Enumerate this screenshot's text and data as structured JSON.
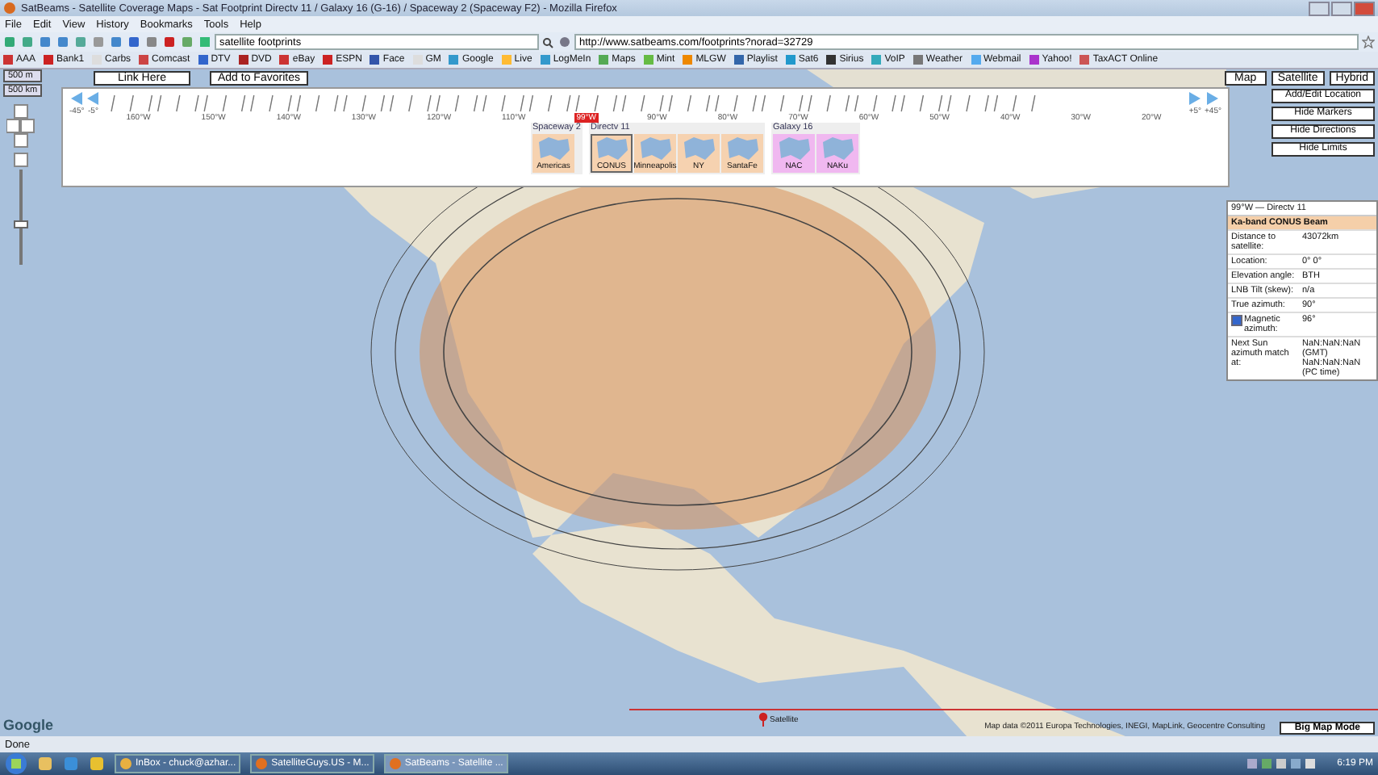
{
  "window": {
    "title": "SatBeams - Satellite Coverage Maps - Sat Footprint Directv 11 / Galaxy 16 (G-16) / Spaceway 2 (Spaceway F2) - Mozilla Firefox"
  },
  "menu": [
    "File",
    "Edit",
    "View",
    "History",
    "Bookmarks",
    "Tools",
    "Help"
  ],
  "search": {
    "value": "satellite footprints"
  },
  "address": {
    "value": "http://www.satbeams.com/footprints?norad=32729"
  },
  "bookmarks": [
    "AAA",
    "Bank1",
    "Carbs",
    "Comcast",
    "DTV",
    "DVD",
    "eBay",
    "ESPN",
    "Face",
    "GM",
    "Google",
    "Live",
    "LogMeIn",
    "Maps",
    "Mint",
    "MLGW",
    "Playlist",
    "Sat6",
    "Sirius",
    "VoIP",
    "Weather",
    "Webmail",
    "Yahoo!",
    "TaxACT Online"
  ],
  "scale": [
    "500 m",
    "500 km"
  ],
  "page_buttons": [
    "Link Here",
    "Add to Favorites"
  ],
  "map_types": [
    {
      "label": "Map",
      "selected": false
    },
    {
      "label": "Satellite",
      "selected": false
    },
    {
      "label": "Hybrid",
      "selected": false
    }
  ],
  "side_buttons": [
    "Add/Edit Location",
    "Hide Markers",
    "Hide Directions",
    "Hide Limits"
  ],
  "strip": {
    "left": [
      "-45°",
      "-5°"
    ],
    "right": [
      "+5°",
      "+45°"
    ],
    "longitudes": [
      {
        "label": "160°W",
        "selected": false
      },
      {
        "label": "150°W",
        "selected": false
      },
      {
        "label": "140°W",
        "selected": false
      },
      {
        "label": "130°W",
        "selected": false
      },
      {
        "label": "120°W",
        "selected": false
      },
      {
        "label": "110°W",
        "selected": false
      },
      {
        "label": "99°W",
        "selected": true
      },
      {
        "label": "90°W",
        "selected": false
      },
      {
        "label": "80°W",
        "selected": false
      },
      {
        "label": "70°W",
        "selected": false
      },
      {
        "label": "60°W",
        "selected": false
      },
      {
        "label": "50°W",
        "selected": false
      },
      {
        "label": "40°W",
        "selected": false
      },
      {
        "label": "30°W",
        "selected": false
      },
      {
        "label": "20°W",
        "selected": false
      }
    ],
    "satellites": [
      {
        "name": "Spaceway 2",
        "color": "#f6d2b0",
        "beams": [
          {
            "label": "Americas",
            "selected": false
          }
        ]
      },
      {
        "name": "Directv 11",
        "color": "#f6d2b0",
        "beams": [
          {
            "label": "CONUS",
            "selected": true
          },
          {
            "label": "Minneapolis",
            "selected": false
          },
          {
            "label": "NY",
            "selected": false
          },
          {
            "label": "SantaFe",
            "selected": false
          }
        ]
      },
      {
        "name": "Galaxy 16",
        "color": "#f0b8f0",
        "beams": [
          {
            "label": "NAC",
            "selected": false
          },
          {
            "label": "NAKu",
            "selected": false
          }
        ]
      }
    ]
  },
  "info": {
    "title": "99°W — Directv 11",
    "beam": "Ka-band CONUS Beam",
    "rows": [
      {
        "kind": "text",
        "label": "Distance to satellite:",
        "value": "43072km"
      },
      {
        "kind": "text",
        "label": "Location:",
        "value": "0° 0°"
      },
      {
        "kind": "text",
        "label": "Elevation angle:",
        "value": "BTH"
      },
      {
        "kind": "text",
        "label": "LNB Tilt (skew):",
        "value": "n/a"
      },
      {
        "kind": "text",
        "label": "True azimuth:",
        "value": "90°"
      },
      {
        "kind": "check",
        "label": "Magnetic azimuth:",
        "value": "96°",
        "checked": true
      },
      {
        "kind": "text",
        "label": "Next Sun azimuth match at:",
        "value": "NaN:NaN:NaN (GMT)\nNaN:NaN:NaN (PC time)"
      }
    ]
  },
  "map": {
    "logo": "Google",
    "pin_label": "Satellite",
    "copyright": "Map data ©2011 Europa Technologies, INEGI, MapLink, Geocentre Consulting",
    "big_map": "Big Map Mode"
  },
  "status_bar": {
    "text": "Done"
  },
  "taskbar": {
    "items": [
      "InBox - chuck@azhar...",
      "SatelliteGuys.US - M...",
      "SatBeams - Satellite ..."
    ],
    "clock": "6:19 PM"
  }
}
